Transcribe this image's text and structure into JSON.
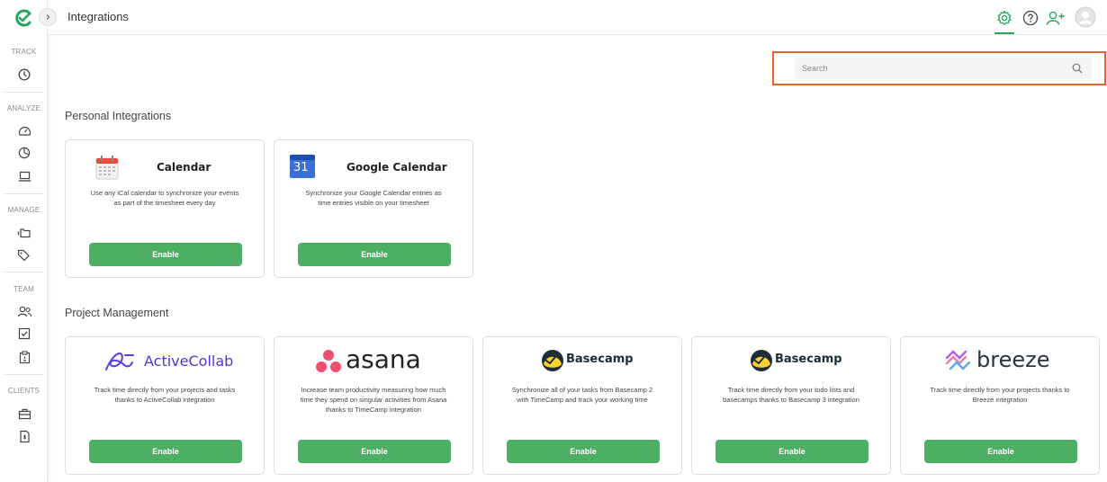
{
  "app": {
    "page_title": "Integrations"
  },
  "sidebar": {
    "sections": [
      {
        "label": "TRACK"
      },
      {
        "label": "ANALYZE"
      },
      {
        "label": "MANAGE"
      },
      {
        "label": "TEAM"
      },
      {
        "label": "CLIENTS"
      }
    ]
  },
  "search": {
    "placeholder": "Search",
    "value": ""
  },
  "sections": {
    "personal": {
      "title": "Personal Integrations",
      "cards": [
        {
          "name": "Calendar",
          "description_1": "Use any iCal calendar to synchronize your events",
          "description_2": "as part of the timesheet every day",
          "button": "Enable"
        },
        {
          "name": "Google Calendar",
          "icon_text": "31",
          "description_1": "Synchronize your Google Calendar entries as",
          "description_2": "time entries visible on your timesheet",
          "button": "Enable"
        }
      ]
    },
    "project_management": {
      "title": "Project Management",
      "cards": [
        {
          "brand": "ActiveCollab",
          "description_1": "Track time directly from your projects and tasks",
          "description_2": "thanks to ActiveCollab integration",
          "description_3": "",
          "button": "Enable"
        },
        {
          "brand": "asana",
          "description_1": "Increase team productivity measuring how much",
          "description_2": "time they spend on singular activities from Asana",
          "description_3": "thanks to TimeCamp integration",
          "button": "Enable"
        },
        {
          "brand": "Basecamp",
          "description_1": "Synchronize all of your tasks from Basecamp 2",
          "description_2": "with TimeCamp and track your working time",
          "description_3": "",
          "button": "Enable"
        },
        {
          "brand": "Basecamp",
          "description_1": "Track time directly from your todo lists and",
          "description_2": "basecamps thanks to Basecamp 3 integration",
          "description_3": "",
          "button": "Enable"
        },
        {
          "brand": "breeze",
          "description_1": "Track time directly from your projects thanks to",
          "description_2": "Breeze integration",
          "description_3": "",
          "button": "Enable"
        }
      ]
    }
  },
  "colors": {
    "accent": "#4caf63",
    "brand_green": "#25a55f",
    "highlight": "#e8632b"
  }
}
